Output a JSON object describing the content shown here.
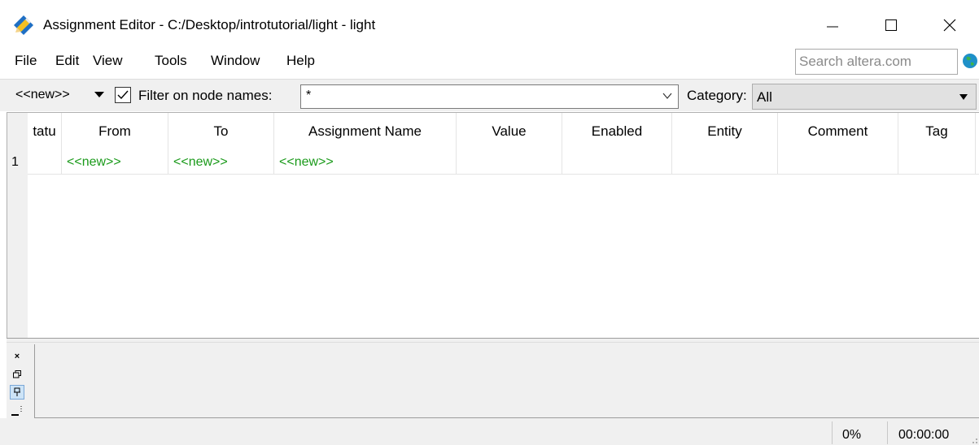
{
  "window": {
    "title": "Assignment Editor - C:/Desktop/introtutorial/light - light"
  },
  "menu": {
    "items": [
      "File",
      "Edit",
      "View",
      "Tools",
      "Window",
      "Help"
    ]
  },
  "search": {
    "placeholder": "Search altera.com"
  },
  "toolbar": {
    "new_dropdown": "<<new>>",
    "filter_checked": true,
    "filter_label": "Filter on node names:",
    "filter_value": "*",
    "category_label": "Category:",
    "category_value": "All"
  },
  "table": {
    "columns": [
      "tatu",
      "From",
      "To",
      "Assignment Name",
      "Value",
      "Enabled",
      "Entity",
      "Comment",
      "Tag"
    ],
    "rows": [
      {
        "num": "1",
        "from": "<<new>>",
        "to": "<<new>>",
        "assignment_name": "<<new>>",
        "value": "",
        "enabled": "",
        "entity": "",
        "comment": "",
        "tag": ""
      }
    ]
  },
  "side_buttons": {
    "close": "×",
    "restore": "🗗",
    "pin": "📌"
  },
  "status": {
    "progress": "0%",
    "time": "00:00:00"
  },
  "colors": {
    "new_text": "#1a9a1a",
    "toolbar_bg": "#f0f0f0"
  }
}
